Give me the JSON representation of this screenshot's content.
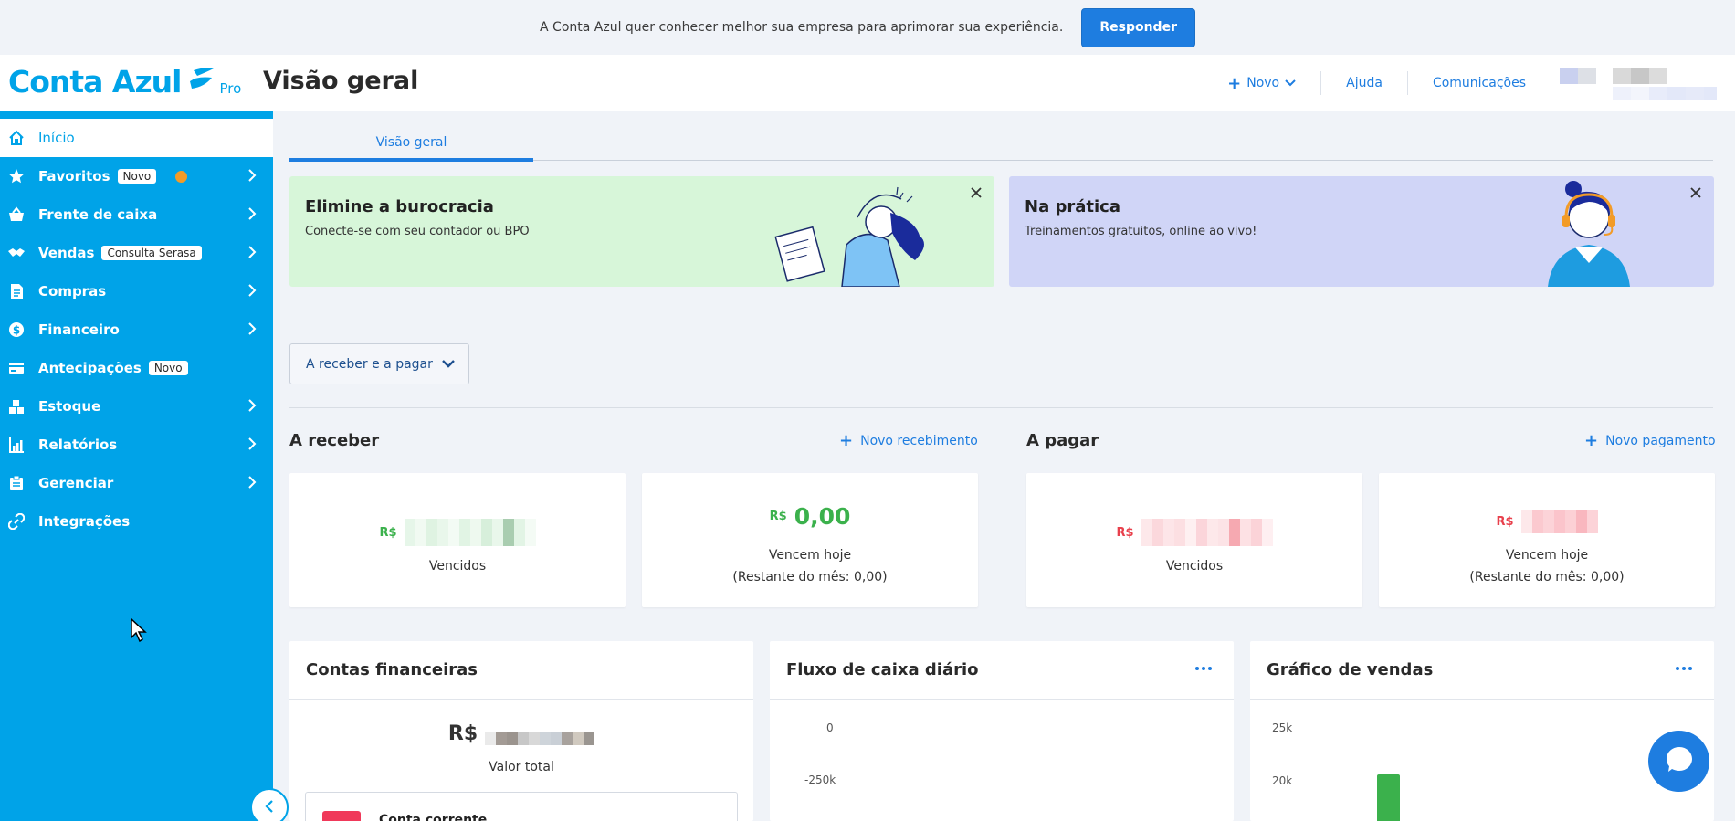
{
  "survey": {
    "message": "A Conta Azul quer conhecer melhor sua empresa para aprimorar sua experiência.",
    "button": "Responder"
  },
  "header": {
    "logo_text": "Conta Azul",
    "logo_badge": "Pro",
    "page_title": "Visão geral",
    "nav": {
      "novo": "Novo",
      "ajuda": "Ajuda",
      "comunicacoes": "Comunicações"
    }
  },
  "sidebar": {
    "items": [
      {
        "label": "Início",
        "icon": "home-icon"
      },
      {
        "label": "Favoritos",
        "badge": "Novo",
        "icon": "star-icon"
      },
      {
        "label": "Frente de caixa",
        "icon": "basket-icon"
      },
      {
        "label": "Vendas",
        "badge": "Consulta Serasa",
        "icon": "handshake-icon"
      },
      {
        "label": "Compras",
        "icon": "document-icon"
      },
      {
        "label": "Financeiro",
        "icon": "dollar-icon"
      },
      {
        "label": "Antecipações",
        "badge": "Novo",
        "icon": "card-icon"
      },
      {
        "label": "Estoque",
        "icon": "boxes-icon"
      },
      {
        "label": "Relatórios",
        "icon": "chart-icon"
      },
      {
        "label": "Gerenciar",
        "icon": "clipboard-icon"
      },
      {
        "label": "Integrações",
        "icon": "link-icon"
      }
    ]
  },
  "tabs": {
    "active": "Visão geral"
  },
  "promos": [
    {
      "title": "Elimine a burocracia",
      "text": "Conecte-se com seu contador ou BPO"
    },
    {
      "title": "Na prática",
      "text": "Treinamentos gratuitos, online ao vivo!"
    }
  ],
  "filter": {
    "label": "A receber e a pagar"
  },
  "receivable": {
    "title": "A receber",
    "action": "Novo recebimento",
    "cards": [
      {
        "currency": "R$",
        "label": "Vencidos"
      },
      {
        "currency": "R$",
        "value": "0,00",
        "label": "Vencem hoje",
        "sub": "(Restante do mês: 0,00)"
      }
    ]
  },
  "payable": {
    "title": "A pagar",
    "action": "Novo pagamento",
    "cards": [
      {
        "currency": "R$",
        "label": "Vencidos"
      },
      {
        "currency": "R$",
        "label": "Vencem hoje",
        "sub": "(Restante do mês: 0,00)"
      }
    ]
  },
  "panels": {
    "accounts": {
      "title": "Contas financeiras",
      "currency": "R$",
      "total_label": "Valor total",
      "row_label": "Conta corrente"
    },
    "cashflow": {
      "title": "Fluxo de caixa diário",
      "ticks": [
        "0",
        "-250k"
      ]
    },
    "sales": {
      "title": "Gráfico de vendas",
      "ticks": [
        "25k",
        "20k"
      ]
    }
  },
  "colors": {
    "brand": "#00a3e8",
    "link": "#1e7de0",
    "green": "#3bb14c",
    "red": "#e8404c"
  }
}
